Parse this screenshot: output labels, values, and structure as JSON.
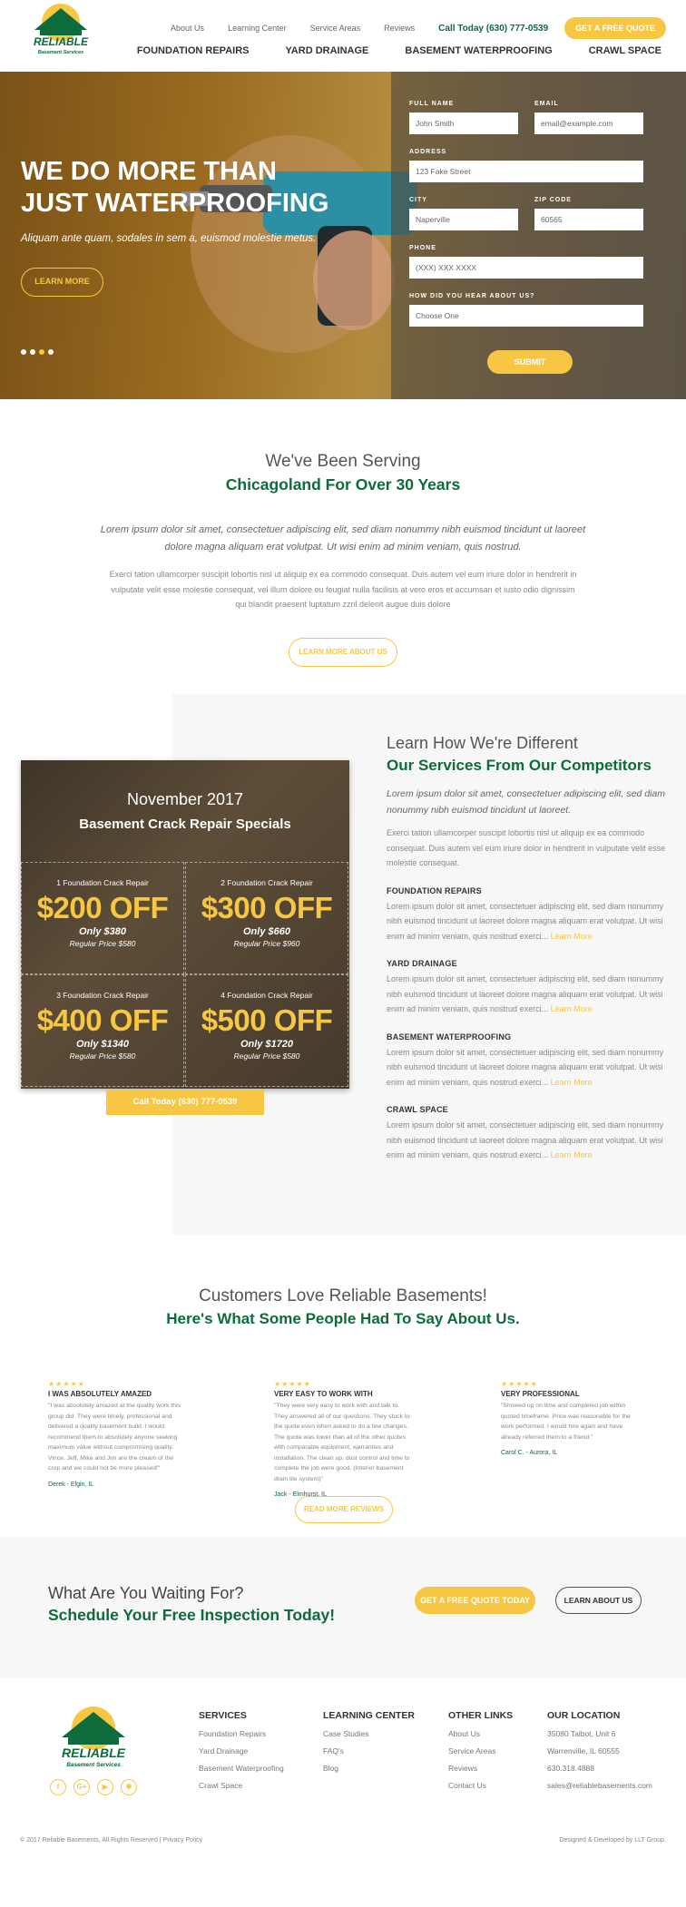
{
  "header": {
    "logo_text": "RELIABLE",
    "logo_sub": "Basement Services",
    "util_links": [
      "About Us",
      "Learning Center",
      "Service Areas",
      "Reviews"
    ],
    "phone": "Call Today (630) 777-0539",
    "quote_button": "GET A FREE QUOTE",
    "main_nav": [
      "FOUNDATION REPAIRS",
      "YARD DRAINAGE",
      "BASEMENT WATERPROOFING",
      "CRAWL SPACE"
    ]
  },
  "hero": {
    "title_line1": "WE DO MORE THAN",
    "title_line2": "JUST WATERPROOFING",
    "subtitle": "Aliquam ante quam, sodales in sem a, euismod molestie metus.",
    "learn_more": "LEARN MORE",
    "form": {
      "full_name_label": "FULL NAME",
      "full_name_placeholder": "John Smith",
      "email_label": "EMAIL",
      "email_placeholder": "email@example.com",
      "address_label": "ADDRESS",
      "address_placeholder": "123 Fake Street",
      "city_label": "CITY",
      "city_placeholder": "Naperville",
      "zip_label": "ZIP CODE",
      "zip_placeholder": "60565",
      "phone_label": "PHONE",
      "phone_placeholder": "(XXX) XXX XXXX",
      "hear_label": "HOW DID YOU HEAR ABOUT US?",
      "hear_selected": "Choose One",
      "submit": "SUBMIT"
    }
  },
  "serving": {
    "heading_light": "We've Been Serving",
    "heading_green": "Chicagoland For Over 30 Years",
    "lead": "Lorem ipsum dolor sit amet, consectetuer adipiscing elit, sed diam nonummy nibh euismod tincidunt ut laoreet dolore magna aliquam erat volutpat. Ut wisi enim ad minim veniam, quis nostrud.",
    "body": "Exerci tation ullamcorper suscipit lobortis nisl ut aliquip ex ea commodo consequat. Duis autem vel eum iriure dolor in hendrerit in vulputate velit esse molestie consequat, vel illum dolore eu feugiat nulla facilisis at vero eros et accumsan et iusto odio dignissim qui blandit praesent luptatum zzril delenit augue duis dolore",
    "button": "LEARN MORE ABOUT US"
  },
  "specials": {
    "month": "November 2017",
    "title": "Basement Crack Repair Specials",
    "items": [
      {
        "label": "1 Foundation Crack Repair",
        "off": "$200 OFF",
        "only": "Only $380",
        "regular": "Regular Price $580"
      },
      {
        "label": "2 Foundation Crack Repair",
        "off": "$300 OFF",
        "only": "Only $660",
        "regular": "Regular Price $960"
      },
      {
        "label": "3 Foundation Crack Repair",
        "off": "$400 OFF",
        "only": "Only $1340",
        "regular": "Regular Price $580"
      },
      {
        "label": "4 Foundation Crack Repair",
        "off": "$500 OFF",
        "only": "Only $1720",
        "regular": "Regular Price $580"
      }
    ],
    "call": "Call Today (630) 777-0539"
  },
  "services": {
    "heading_light": "Learn How We're Different",
    "heading_green": "Our Services From Our Competitors",
    "lead": "Lorem ipsum dolor sit amet, consectetuer adipiscing elit, sed diam nonummy nibh euismod tincidunt ut laoreet.",
    "body": "Exerci tation ullamcorper suscipit lobortis nisl ut aliquip ex ea commodo consequat. Duis autem vel eum iriure dolor in hendrerit in vulputate velit esse molestie consequat.",
    "items": [
      {
        "title": "FOUNDATION REPAIRS",
        "text": "Lorem ipsum dolor sit amet, consectetuer adipiscing elit, sed diam nonummy nibh euismod tincidunt ut laoreet dolore magna aliquam erat volutpat. Ut wisi enim ad minim veniam, quis nostrud exerci...",
        "more": "Learn More"
      },
      {
        "title": "YARD DRAINAGE",
        "text": "Lorem ipsum dolor sit amet, consectetuer adipiscing elit, sed diam nonummy nibh euismod tincidunt ut laoreet dolore magna aliquam erat volutpat. Ut wisi enim ad minim veniam, quis nostrud exerci...",
        "more": "Learn More"
      },
      {
        "title": "BASEMENT WATERPROOFING",
        "text": "Lorem ipsum dolor sit amet, consectetuer adipiscing elit, sed diam nonummy nibh euismod tincidunt ut laoreet dolore magna aliquam erat volutpat. Ut wisi enim ad minim veniam, quis nostrud exerci...",
        "more": "Learn More"
      },
      {
        "title": "CRAWL SPACE",
        "text": "Lorem ipsum dolor sit amet, consectetuer adipiscing elit, sed diam nonummy nibh euismod tincidunt ut laoreet dolore magna aliquam erat volutpat. Ut wisi enim ad minim veniam, quis nostrud exerci...",
        "more": "Learn More"
      }
    ]
  },
  "reviews": {
    "heading_light": "Customers Love Reliable Basements!",
    "heading_green": "Here's What Some People Had To Say About Us.",
    "stars": "★★★★★",
    "items": [
      {
        "title": "I WAS ABSOLUTELY AMAZED",
        "quote": "\"I was absolutely amazed at the quality work this group did. They were timely, professional and delivered a quality basement build. I would recommend them to absolutely anyone seeking maximum value without compromising quality. Vince, Jeff, Mike and Jim are the cream of the crop and we could not be more pleased!\"",
        "author": "Derek - Elgin, IL"
      },
      {
        "title": "VERY EASY TO WORK WITH",
        "quote": "\"They were very easy to work with and talk to. They answered all of our questions. They stuck to the quote even when asked to do a few changes. The quote was lower than all of the other quotes with comparable equipment, warranties and installation. The clean up, dust control and time to complete the job were good. (Interior basement drain tile system)\"",
        "author": "Jack - Elmhurst, IL"
      },
      {
        "title": "VERY PROFESSIONAL",
        "quote": "\"Showed up on time and completed job within quoted timeframe. Price was reasonable for the work performed. I would hire again and have already referred them to a friend.\"",
        "author": "Carol C. - Aurora, IL"
      }
    ],
    "button": "READ MORE REVIEWS"
  },
  "cta": {
    "heading_light": "What Are You Waiting For?",
    "heading_green": "Schedule Your Free Inspection Today!",
    "quote_button": "GET A FREE QUOTE TODAY",
    "learn_button": "LEARN ABOUT US"
  },
  "footer": {
    "cols": [
      {
        "title": "SERVICES",
        "items": [
          "Foundation Repairs",
          "Yard Drainage",
          "Basement Waterproofing",
          "Crawl Space"
        ]
      },
      {
        "title": "LEARNING CENTER",
        "items": [
          "Case Studies",
          "FAQ's",
          "Blog"
        ]
      },
      {
        "title": "OTHER LINKS",
        "items": [
          "About Us",
          "Service Areas",
          "Reviews",
          "Contact Us"
        ]
      },
      {
        "title": "OUR LOCATION",
        "items": [
          "35080 Talbot, Unit 6",
          "Warrenville, IL 60555",
          "630.318.4888",
          "sales@reliablebasements.com"
        ]
      }
    ],
    "socials": [
      "facebook-icon",
      "google-plus-icon",
      "youtube-icon",
      "yelp-icon"
    ],
    "copyright": "© 2017 Reliable Basements, All Rights Reserved | Privacy Policy",
    "credit": "Designed & Developed by LLT Group."
  },
  "colors": {
    "green": "#0d6b3c",
    "yellow": "#f7c744"
  }
}
